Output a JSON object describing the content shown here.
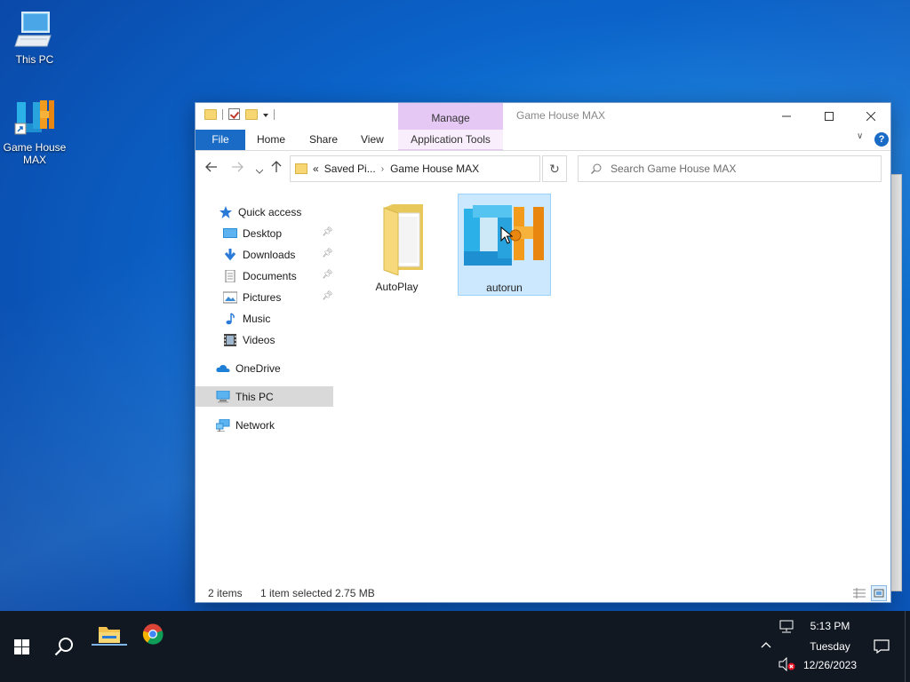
{
  "desktop": {
    "icons": [
      {
        "label": "This PC",
        "icon": "computer-icon"
      },
      {
        "label": "Game House MAX",
        "icon": "app-shortcut-icon"
      }
    ]
  },
  "window": {
    "title": "Game House MAX",
    "context_tab_group": "Manage",
    "tabs": {
      "file": "File",
      "home": "Home",
      "share": "Share",
      "view": "View",
      "app_tools": "Application Tools"
    },
    "help": "?"
  },
  "address": {
    "overflow": "«",
    "segments": [
      "Saved Pi...",
      "Game House MAX"
    ]
  },
  "search": {
    "placeholder": "Search Game House MAX"
  },
  "nav": {
    "quick_access": "Quick access",
    "pinned": [
      {
        "label": "Desktop",
        "icon": "desktop-icon"
      },
      {
        "label": "Downloads",
        "icon": "downloads-icon"
      },
      {
        "label": "Documents",
        "icon": "documents-icon"
      },
      {
        "label": "Pictures",
        "icon": "pictures-icon"
      }
    ],
    "unpinned": [
      {
        "label": "Music",
        "icon": "music-icon"
      },
      {
        "label": "Videos",
        "icon": "videos-icon"
      }
    ],
    "onedrive": "OneDrive",
    "this_pc": "This PC",
    "network": "Network"
  },
  "content": {
    "items": [
      {
        "name": "AutoPlay",
        "type": "folder",
        "selected": false
      },
      {
        "name": "autorun",
        "type": "application",
        "selected": true
      }
    ]
  },
  "status": {
    "count": "2 items",
    "selection": "1 item selected  2.75 MB"
  },
  "taskbar": {
    "pinned": [
      "start-icon",
      "search-icon",
      "file-explorer-icon",
      "chrome-icon"
    ],
    "clock": {
      "time": "5:13 PM",
      "day": "Tuesday",
      "date": "12/26/2023"
    }
  },
  "colors": {
    "accent": "#1a6bc5",
    "manage_tab": "#e6c8f5",
    "selection": "#cce8ff",
    "taskbar": "#111821"
  }
}
